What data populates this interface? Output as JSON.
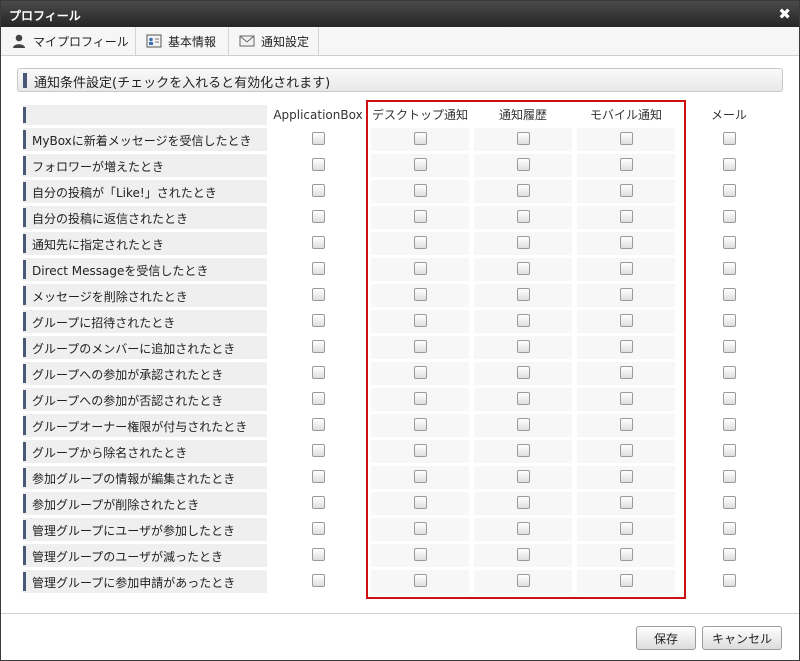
{
  "window": {
    "title": "プロフィール",
    "close_glyph": "✖"
  },
  "tabs": [
    {
      "label": "マイプロフィール",
      "icon": "user-icon",
      "active": true
    },
    {
      "label": "基本情報",
      "icon": "id-card-icon",
      "active": false
    },
    {
      "label": "通知設定",
      "icon": "envelope-icon",
      "active": false
    }
  ],
  "section": {
    "title": "通知条件設定(チェックを入れると有効化されます)"
  },
  "columns": [
    "ApplicationBox",
    "デスクトップ通知",
    "通知履歴",
    "モバイル通知",
    "メール"
  ],
  "rows": [
    "MyBoxに新着メッセージを受信したとき",
    "フォロワーが増えたとき",
    "自分の投稿が「Like!」されたとき",
    "自分の投稿に返信されたとき",
    "通知先に指定されたとき",
    "Direct Messageを受信したとき",
    "メッセージを削除されたとき",
    "グループに招待されたとき",
    "グループのメンバーに追加されたとき",
    "グループへの参加が承認されたとき",
    "グループへの参加が否認されたとき",
    "グループオーナー権限が付与されたとき",
    "グループから除名されたとき",
    "参加グループの情報が編集されたとき",
    "参加グループが削除されたとき",
    "管理グループにユーザが参加したとき",
    "管理グループのユーザが減ったとき",
    "管理グループに参加申請があったとき"
  ],
  "checked": [
    [
      false,
      false,
      false,
      false,
      false
    ],
    [
      false,
      false,
      false,
      false,
      false
    ],
    [
      false,
      false,
      false,
      false,
      false
    ],
    [
      false,
      false,
      false,
      false,
      false
    ],
    [
      false,
      false,
      false,
      false,
      false
    ],
    [
      false,
      false,
      false,
      false,
      false
    ],
    [
      false,
      false,
      false,
      false,
      false
    ],
    [
      false,
      false,
      false,
      false,
      false
    ],
    [
      false,
      false,
      false,
      false,
      false
    ],
    [
      false,
      false,
      false,
      false,
      false
    ],
    [
      false,
      false,
      false,
      false,
      false
    ],
    [
      false,
      false,
      false,
      false,
      false
    ],
    [
      false,
      false,
      false,
      false,
      false
    ],
    [
      false,
      false,
      false,
      false,
      false
    ],
    [
      false,
      false,
      false,
      false,
      false
    ],
    [
      false,
      false,
      false,
      false,
      false
    ],
    [
      false,
      false,
      false,
      false,
      false
    ],
    [
      false,
      false,
      false,
      false,
      false
    ]
  ],
  "buttons": {
    "save": "保存",
    "cancel": "キャンセル"
  },
  "colors": {
    "highlight": "#cc1111",
    "accent_bar": "#4a5878"
  }
}
